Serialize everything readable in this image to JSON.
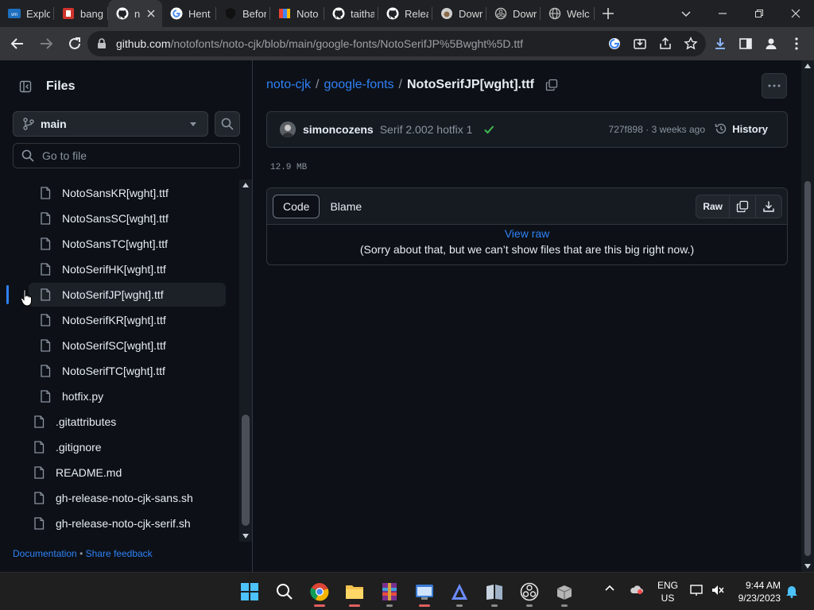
{
  "browser": {
    "tabs": [
      {
        "title": "Explo",
        "icon": "vmware-icon",
        "color": "#1d6fbf"
      },
      {
        "title": "bang",
        "icon": "red-app-icon",
        "color": "#d0342c"
      },
      {
        "title": "n",
        "icon": "github-icon",
        "color": "#ffffff",
        "active": true
      },
      {
        "title": "Hent",
        "icon": "google-icon",
        "color": "#4285f4"
      },
      {
        "title": "Befor",
        "icon": "shield-icon",
        "color": "#222222"
      },
      {
        "title": "Noto",
        "icon": "noto-icon",
        "color": "#4285f4"
      },
      {
        "title": "taitha",
        "icon": "github-icon",
        "color": "#ffffff"
      },
      {
        "title": "Relea",
        "icon": "github-icon",
        "color": "#ffffff"
      },
      {
        "title": "Dowr",
        "icon": "sheep-icon",
        "color": "#cfcfcf"
      },
      {
        "title": "Dowr",
        "icon": "circle-icon",
        "color": "#bbbbbb"
      },
      {
        "title": "Welc",
        "icon": "globe-icon",
        "color": "#bbbbbb"
      }
    ],
    "url_host": "github.com",
    "url_path": "/notofonts/noto-cjk/blob/main/google-fonts/NotoSerifJP%5Bwght%5D.ttf"
  },
  "sidebar": {
    "title": "Files",
    "branch": "main",
    "goto_placeholder": "Go to file",
    "items": [
      {
        "name": "NotoSansKR[wght].ttf",
        "indent": 2
      },
      {
        "name": "NotoSansSC[wght].ttf",
        "indent": 2
      },
      {
        "name": "NotoSansTC[wght].ttf",
        "indent": 2
      },
      {
        "name": "NotoSerifHK[wght].ttf",
        "indent": 2
      },
      {
        "name": "NotoSerifJP[wght].ttf",
        "indent": 2,
        "selected": true
      },
      {
        "name": "NotoSerifKR[wght].ttf",
        "indent": 2
      },
      {
        "name": "NotoSerifSC[wght].ttf",
        "indent": 2
      },
      {
        "name": "NotoSerifTC[wght].ttf",
        "indent": 2
      },
      {
        "name": "hotfix.py",
        "indent": 2
      },
      {
        "name": ".gitattributes",
        "indent": 1
      },
      {
        "name": ".gitignore",
        "indent": 1
      },
      {
        "name": "README.md",
        "indent": 1
      },
      {
        "name": "gh-release-noto-cjk-sans.sh",
        "indent": 1
      },
      {
        "name": "gh-release-noto-cjk-serif.sh",
        "indent": 1
      }
    ],
    "footer": {
      "docs": "Documentation",
      "sep": "•",
      "feedback": "Share feedback"
    }
  },
  "breadcrumb": {
    "repo": "noto-cjk",
    "folder": "google-fonts",
    "sep": "/",
    "file": "NotoSerifJP[wght].ttf"
  },
  "commit": {
    "author": "simoncozens",
    "message": "Serif 2.002 hotfix 1",
    "hash": "727f898",
    "dot": "·",
    "when": "3 weeks ago",
    "history_label": "History"
  },
  "file": {
    "size": "12.9 MB",
    "tabs": [
      "Code",
      "Blame"
    ],
    "raw_label": "Raw",
    "view_raw": "View raw",
    "too_big": "(Sorry about that, but we can’t show files that are this big right now.)"
  },
  "taskbar": {
    "lang_top": "ENG",
    "lang_bottom": "US",
    "time": "9:44 AM",
    "date": "9/23/2023"
  }
}
